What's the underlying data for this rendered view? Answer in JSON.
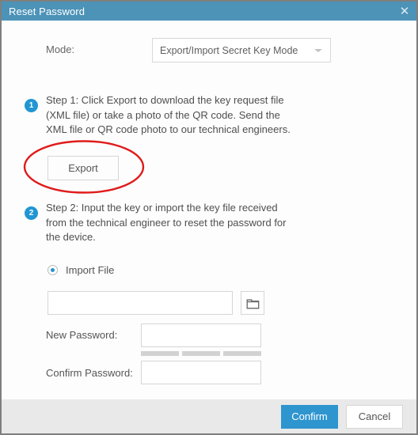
{
  "window": {
    "title": "Reset Password",
    "close_icon": "close-icon",
    "titlebar_color": "#4d93b8"
  },
  "mode": {
    "label": "Mode:",
    "selected": "Export/Import Secret Key Mode",
    "options": [
      "Export/Import Secret Key Mode"
    ],
    "chevron_icon": "chevron-down-icon"
  },
  "steps": [
    {
      "number": "1",
      "text": "Step 1: Click Export to download the key request file (XML file) or take a photo of the QR code. Send the XML file or QR code photo to our technical engineers.",
      "badge_color": "#2196d3"
    },
    {
      "number": "2",
      "text": "Step 2: Input the key or import the key file received from the technical engineer to reset the password for the device.",
      "badge_color": "#2196d3"
    }
  ],
  "export": {
    "label": "Export"
  },
  "annotation": {
    "shape": "ellipse",
    "color": "#e01b1b",
    "target": "export-button"
  },
  "import": {
    "radio_label": "Import File",
    "radio_selected": true,
    "file_value": "",
    "file_placeholder": "",
    "browse_icon": "folder-icon"
  },
  "password": {
    "new_label": "New Password:",
    "new_value": "",
    "confirm_label": "Confirm Password:",
    "confirm_value": "",
    "strength_segments": 3,
    "strength_filled": 0,
    "strength_color": "#d2d2d2"
  },
  "footer": {
    "confirm_label": "Confirm",
    "cancel_label": "Cancel",
    "confirm_color": "#2f95cf"
  }
}
